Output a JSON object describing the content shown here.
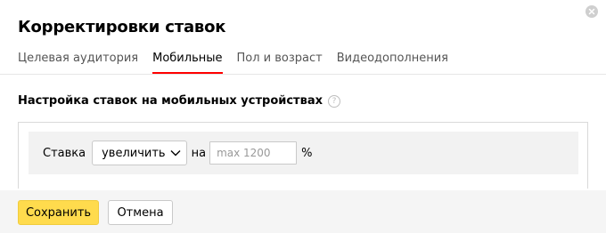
{
  "dialog": {
    "title": "Корректировки ставок",
    "tabs": [
      {
        "label": "Целевая аудитория",
        "active": false
      },
      {
        "label": "Мобильные",
        "active": true
      },
      {
        "label": "Пол и возраст",
        "active": false
      },
      {
        "label": "Видеодополнения",
        "active": false
      }
    ],
    "section_title": "Настройка ставок на мобильных устройствах",
    "help_icon": "question-circle-icon",
    "rate": {
      "label": "Ставка",
      "mode_selected": "увеличить",
      "connector": "на",
      "value": "",
      "placeholder": "max 1200",
      "unit": "%"
    },
    "buttons": {
      "save": "Сохранить",
      "cancel": "Отмена"
    }
  },
  "colors": {
    "accent_tab": "#ff0000",
    "primary_button": "#ffdb4d",
    "footer_bg": "#f5f5f5",
    "panel_bg": "#f2f2f2"
  }
}
